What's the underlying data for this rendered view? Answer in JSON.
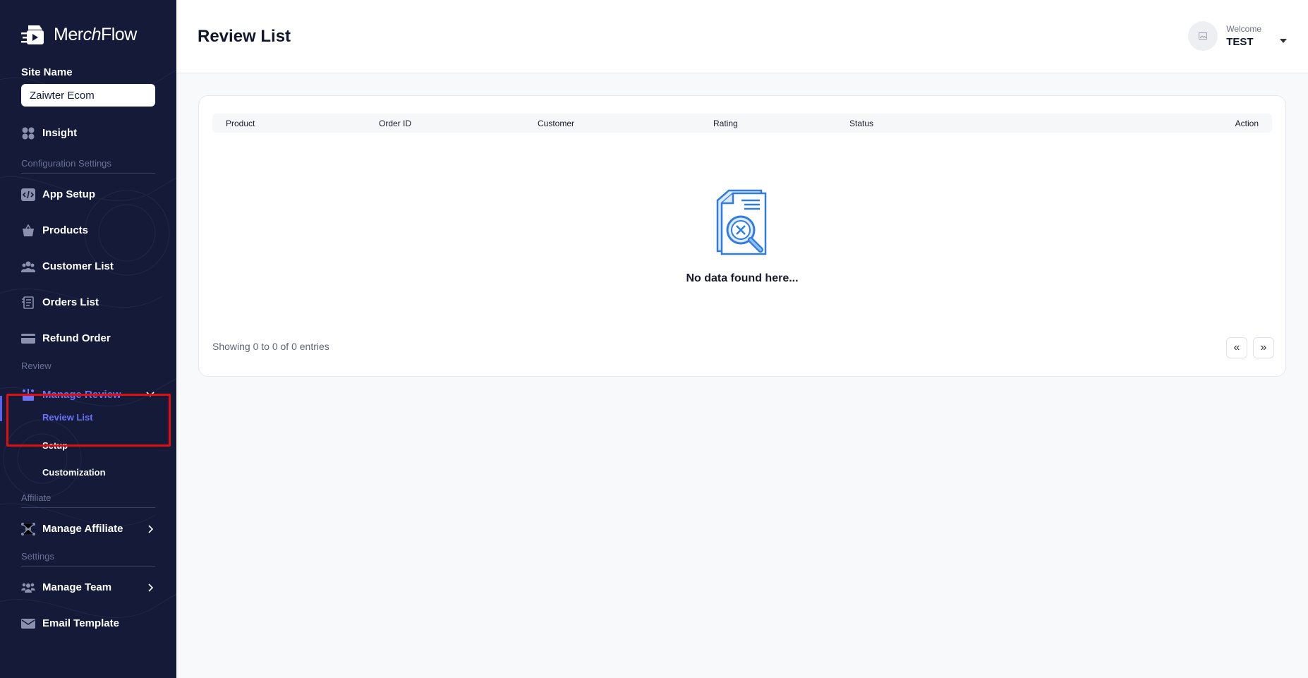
{
  "brand": {
    "name_prefix": "Merch",
    "name_italic": "ch",
    "name_suffix": "Flow",
    "logo_parts": [
      "Mer",
      "ch",
      "Flow"
    ]
  },
  "site": {
    "label": "Site Name",
    "value": "Zaiwter Ecom"
  },
  "nav": {
    "insight": "Insight",
    "section_config": "Configuration Settings",
    "app_setup": "App Setup",
    "products": "Products",
    "customer_list": "Customer List",
    "orders_list": "Orders List",
    "refund_order": "Refund Order",
    "section_review": "Review",
    "manage_review": "Manage Review",
    "review_list": "Review List",
    "setup": "Setup",
    "customization": "Customization",
    "section_affiliate": "Affiliate",
    "manage_affiliate": "Manage Affiliate",
    "section_settings": "Settings",
    "manage_team": "Manage Team",
    "email_template": "Email Template"
  },
  "header": {
    "title": "Review List",
    "welcome": "Welcome",
    "username": "TEST"
  },
  "table": {
    "columns": [
      "Product",
      "Order ID",
      "Customer",
      "Rating",
      "Status",
      "Action"
    ],
    "empty_message": "No data found here...",
    "showing": "Showing 0 to 0 of 0 entries",
    "prev_label": "«",
    "next_label": "»"
  },
  "colors": {
    "sidebar_bg": "#141a38",
    "accent": "#6a72f7",
    "highlight": "#e01010",
    "illustration": "#2f7de0"
  }
}
